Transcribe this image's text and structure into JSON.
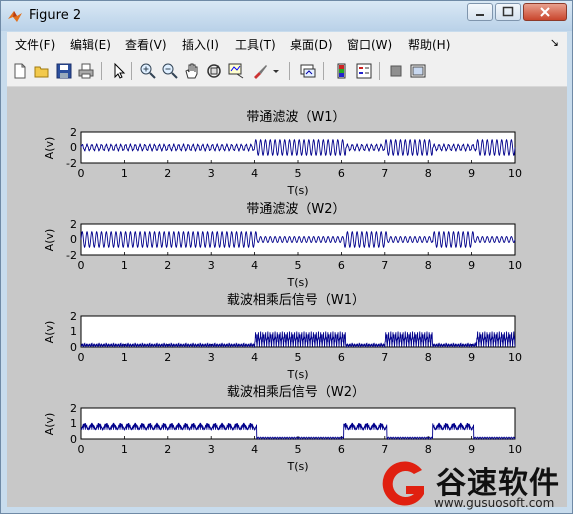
{
  "window": {
    "title": "Figure 2"
  },
  "menu": [
    "文件(F)",
    "编辑(E)",
    "查看(V)",
    "插入(I)",
    "工具(T)",
    "桌面(D)",
    "窗口(W)",
    "帮助(H)"
  ],
  "toolbar": {
    "icons": [
      "new-file-icon",
      "open-folder-icon",
      "save-icon",
      "print-icon",
      "pointer-icon",
      "zoom-in-icon",
      "zoom-out-icon",
      "pan-hand-icon",
      "rotate-3d-icon",
      "data-cursor-icon",
      "brush-icon",
      "dropdown-arrow-icon",
      "link-plot-icon",
      "colorbar-icon",
      "legend-icon",
      "hide-plot-tools-icon",
      "show-plot-tools-icon"
    ]
  },
  "plots": [
    {
      "title": "带通滤波（W1）",
      "xlabel": "T(s)",
      "ylabel": "A(v)",
      "yticks": [
        "2",
        "0",
        "-2"
      ],
      "xticks": [
        "0",
        "1",
        "2",
        "3",
        "4",
        "5",
        "6",
        "7",
        "8",
        "9",
        "10"
      ]
    },
    {
      "title": "带通滤波（W2）",
      "xlabel": "T(s)",
      "ylabel": "A(v)",
      "yticks": [
        "2",
        "0",
        "-2"
      ],
      "xticks": [
        "0",
        "1",
        "2",
        "3",
        "4",
        "5",
        "6",
        "7",
        "8",
        "9",
        "10"
      ]
    },
    {
      "title": "载波相乘后信号（W1）",
      "xlabel": "T(s)",
      "ylabel": "A(v)",
      "yticks": [
        "2",
        "1",
        "0"
      ],
      "xticks": [
        "0",
        "1",
        "2",
        "3",
        "4",
        "5",
        "6",
        "7",
        "8",
        "9",
        "10"
      ]
    },
    {
      "title": "载波相乘后信号（W2）",
      "xlabel": "T(s)",
      "ylabel": "A(v)",
      "yticks": [
        "2",
        "1",
        "0"
      ],
      "xticks": [
        "0",
        "1",
        "2",
        "3",
        "4",
        "5",
        "6",
        "7",
        "8",
        "9",
        "10"
      ]
    }
  ],
  "watermark": {
    "text": "谷速软件",
    "url": "www.gusuosoft.com"
  },
  "colors": {
    "line": "#00008b",
    "figure_bg": "#c8c8c8",
    "axes_bg": "#ffffff"
  }
}
